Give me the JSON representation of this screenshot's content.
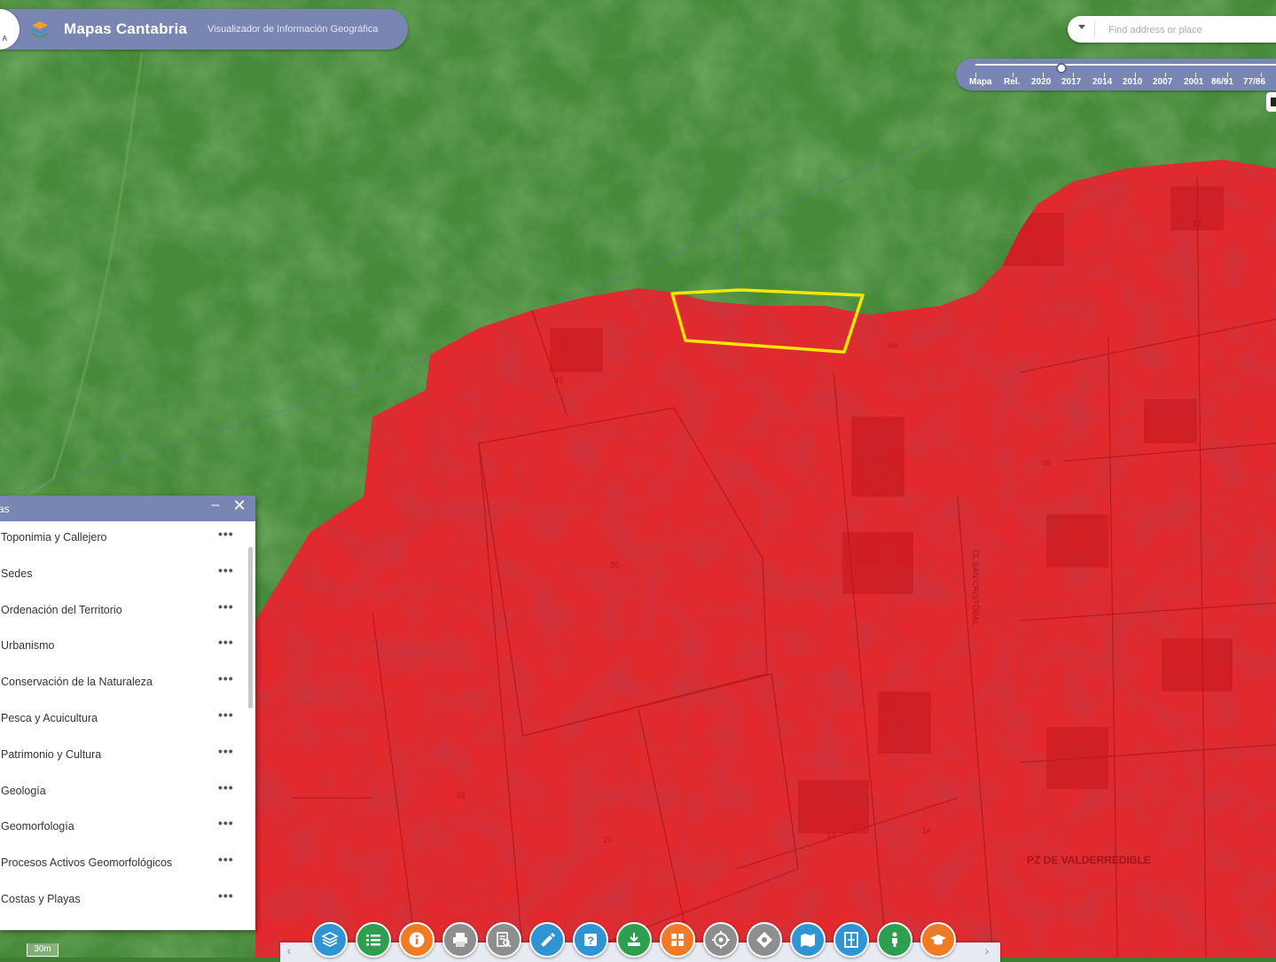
{
  "header": {
    "logo_caption": "A",
    "title": "Mapas Cantabria",
    "subtitle": "Visualizador de Información Geográfica"
  },
  "search": {
    "placeholder": "Find address or place"
  },
  "timeline": {
    "labels": [
      "Mapa",
      "Rel.",
      "2020",
      "2017",
      "2014",
      "2010",
      "2007",
      "2001",
      "86/91",
      "77/86"
    ],
    "selected": "2020"
  },
  "layers_panel": {
    "title": "as",
    "items": [
      "Toponimia y Callejero",
      "Sedes",
      "Ordenación del Territorio",
      "Urbanismo",
      "Conservación de la Naturaleza",
      "Pesca y Acuicultura",
      "Patrimonio y Cultura",
      "Geología",
      "Geomorfología",
      "Procesos Activos Geomorfológicos",
      "Costas y Playas"
    ],
    "item_menu": "•••"
  },
  "map": {
    "street_label_1": "PZ DE VALDERREDIBLE",
    "street_label_2": "CL SAN CRISTÓBAL",
    "parcel_numbers": [
      "20",
      "22",
      "23",
      "13",
      "14",
      "12",
      "06",
      "03",
      "45"
    ],
    "colors": {
      "green": "#3f7d33",
      "red": "#e3262b",
      "highlight": "#f2e600"
    }
  },
  "scale": {
    "label": "30m"
  },
  "toolbar": {
    "buttons": [
      {
        "icon": "layers-icon",
        "color": "#2f94d4"
      },
      {
        "icon": "list-icon",
        "color": "#2e9e4f"
      },
      {
        "icon": "info-icon",
        "color": "#f07b24"
      },
      {
        "icon": "print-icon",
        "color": "#8e8e8e"
      },
      {
        "icon": "query-icon",
        "color": "#8e8e8e"
      },
      {
        "icon": "measure-icon",
        "color": "#2f94d4"
      },
      {
        "icon": "help-icon",
        "color": "#2f94d4"
      },
      {
        "icon": "download-icon",
        "color": "#2e9e4f"
      },
      {
        "icon": "grid-icon",
        "color": "#f07b24"
      },
      {
        "icon": "target-icon",
        "color": "#8e8e8e"
      },
      {
        "icon": "compass-icon",
        "color": "#8e8e8e"
      },
      {
        "icon": "map-icon",
        "color": "#2f94d4"
      },
      {
        "icon": "split-icon",
        "color": "#2f94d4"
      },
      {
        "icon": "streetview-icon",
        "color": "#2e9e4f"
      },
      {
        "icon": "education-icon",
        "color": "#f07b24"
      }
    ]
  }
}
